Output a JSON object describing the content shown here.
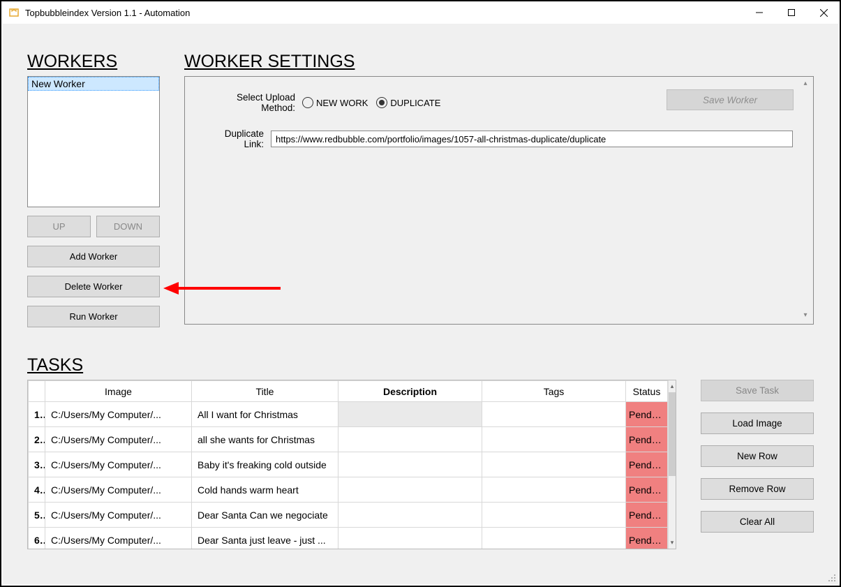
{
  "window": {
    "title": "Topbubbleindex Version 1.1 - Automation"
  },
  "sections": {
    "workers_title": "WORKERS",
    "settings_title": "WORKER SETTINGS",
    "tasks_title": "TASKS"
  },
  "workers": {
    "items": [
      {
        "label": "New Worker"
      }
    ],
    "buttons": {
      "up": "UP",
      "down": "DOWN",
      "add": "Add Worker",
      "delete": "Delete Worker",
      "run": "Run Worker"
    }
  },
  "settings": {
    "upload_label": "Select Upload Method:",
    "radio_new": "NEW WORK",
    "radio_duplicate": "DUPLICATE",
    "save_button": "Save Worker",
    "duplicate_label": "Duplicate Link:",
    "duplicate_value": "https://www.redbubble.com/portfolio/images/1057-all-christmas-duplicate/duplicate"
  },
  "tasks": {
    "headers": {
      "image": "Image",
      "title": "Title",
      "description": "Description",
      "tags": "Tags",
      "status": "Status"
    },
    "rows": [
      {
        "n": "1",
        "image": "C:/Users/My Computer/...",
        "title": "All I want for Christmas",
        "description": "",
        "tags": "",
        "status": "Pending"
      },
      {
        "n": "2",
        "image": "C:/Users/My Computer/...",
        "title": "all she wants for Christmas",
        "description": "",
        "tags": "",
        "status": "Pending"
      },
      {
        "n": "3",
        "image": "C:/Users/My Computer/...",
        "title": "Baby it's freaking cold outside",
        "description": "",
        "tags": "",
        "status": "Pending"
      },
      {
        "n": "4",
        "image": "C:/Users/My Computer/...",
        "title": "Cold hands warm heart",
        "description": "",
        "tags": "",
        "status": "Pending"
      },
      {
        "n": "5",
        "image": "C:/Users/My Computer/...",
        "title": "Dear Santa Can we negociate",
        "description": "",
        "tags": "",
        "status": "Pending"
      },
      {
        "n": "6",
        "image": "C:/Users/My Computer/...",
        "title": "Dear Santa just leave - just ...",
        "description": "",
        "tags": "",
        "status": "Pending"
      }
    ],
    "buttons": {
      "save": "Save Task",
      "load": "Load Image",
      "newrow": "New Row",
      "remove": "Remove Row",
      "clear": "Clear All"
    }
  }
}
